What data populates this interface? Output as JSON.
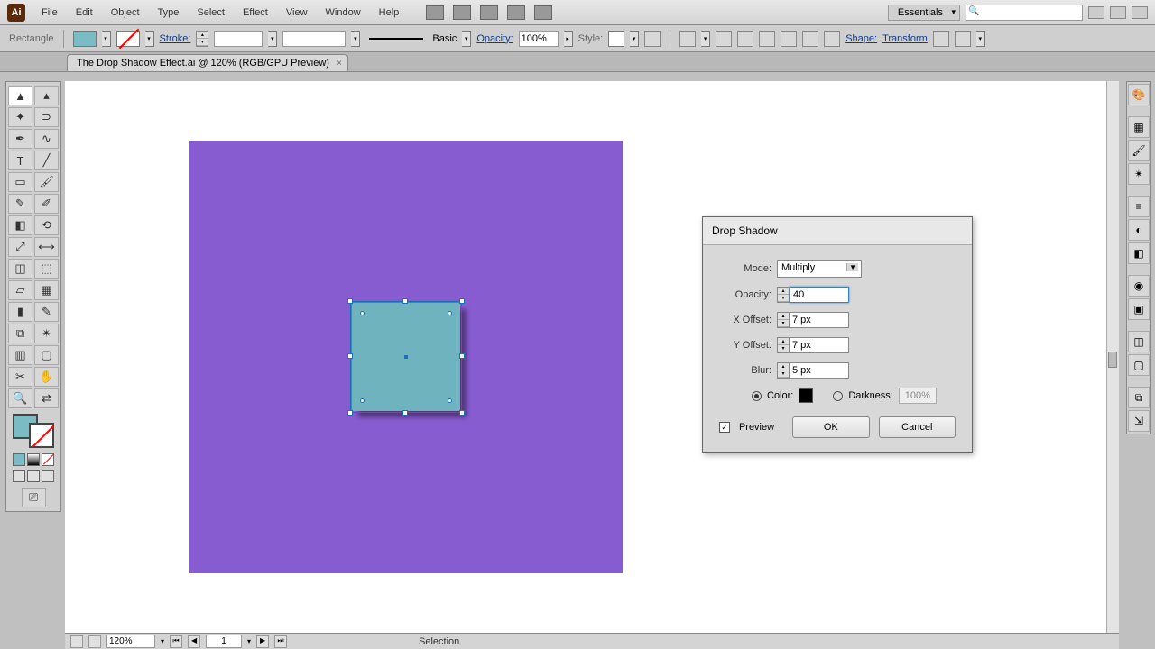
{
  "menubar": {
    "items": [
      "File",
      "Edit",
      "Object",
      "Type",
      "Select",
      "Effect",
      "View",
      "Window",
      "Help"
    ],
    "workspace": "Essentials"
  },
  "controlbar": {
    "shape": "Rectangle",
    "stroke_label": "Stroke:",
    "brush_label": "Basic",
    "opacity_label": "Opacity:",
    "opacity_value": "100%",
    "style_label": "Style:",
    "shape_link": "Shape:",
    "transform_link": "Transform"
  },
  "document": {
    "tab": "The Drop Shadow Effect.ai @ 120% (RGB/GPU Preview)"
  },
  "dialog": {
    "title": "Drop Shadow",
    "mode_label": "Mode:",
    "mode_value": "Multiply",
    "opacity_label": "Opacity:",
    "opacity_value": "40",
    "xoffset_label": "X Offset:",
    "xoffset_value": "7 px",
    "yoffset_label": "Y Offset:",
    "yoffset_value": "7 px",
    "blur_label": "Blur:",
    "blur_value": "5 px",
    "color_label": "Color:",
    "darkness_label": "Darkness:",
    "darkness_value": "100%",
    "preview_label": "Preview",
    "ok": "OK",
    "cancel": "Cancel"
  },
  "status": {
    "zoom": "120%",
    "artboard": "1",
    "tool": "Selection"
  }
}
